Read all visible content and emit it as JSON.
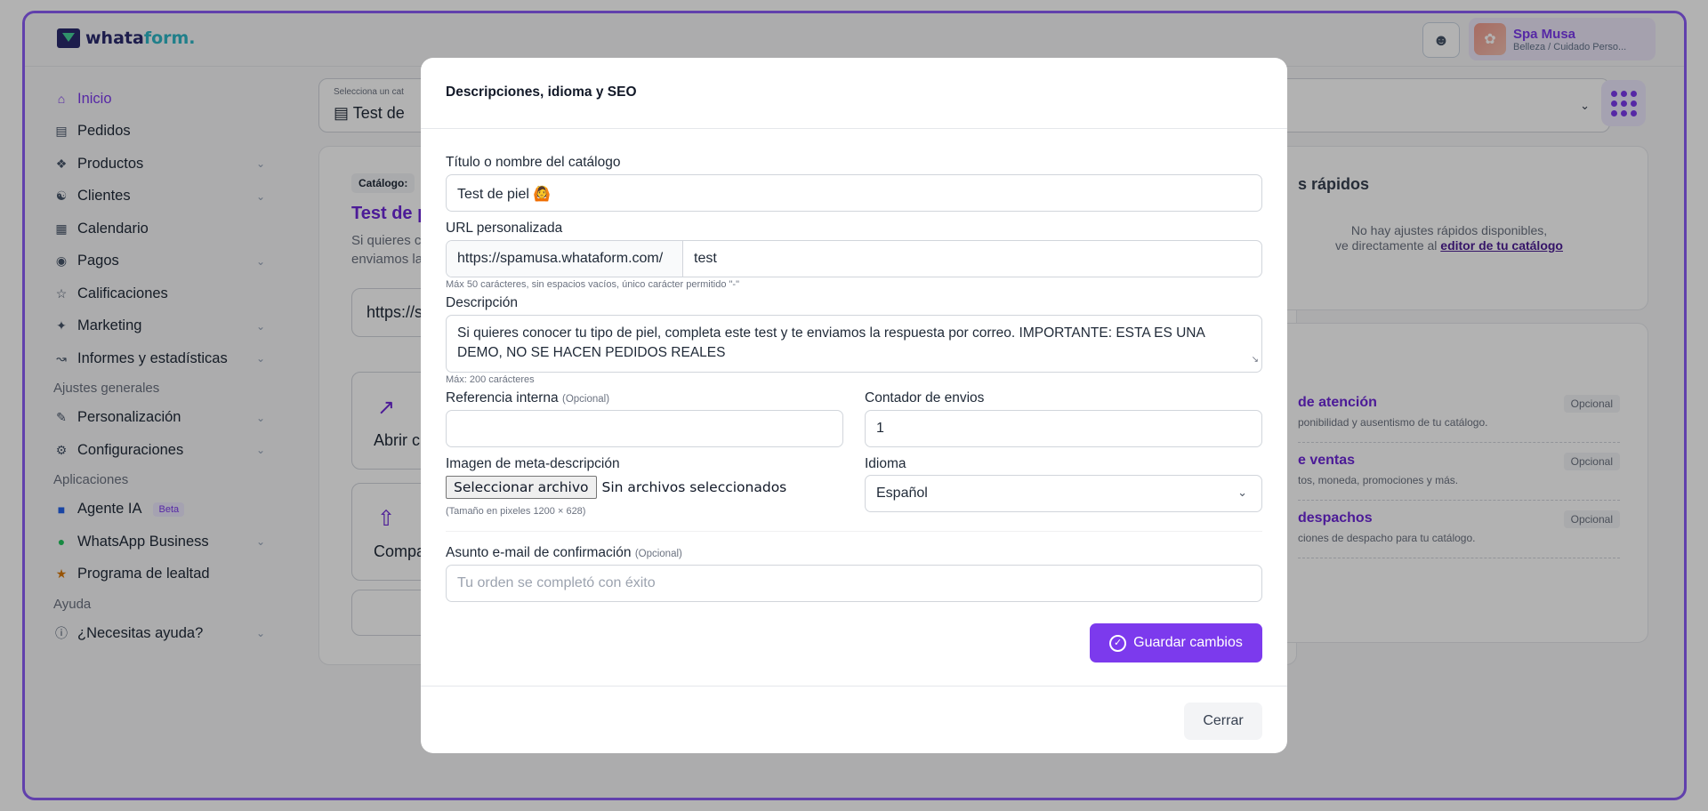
{
  "app": {
    "logo_main": "whata",
    "logo_accent": "form."
  },
  "account": {
    "name": "Spa Musa",
    "subtitle": "Belleza / Cuidado Perso..."
  },
  "sidebar": {
    "items": [
      {
        "label": "Inicio",
        "icon": "home-icon"
      },
      {
        "label": "Pedidos",
        "icon": "orders-icon"
      },
      {
        "label": "Productos",
        "icon": "products-icon"
      },
      {
        "label": "Clientes",
        "icon": "clients-icon"
      },
      {
        "label": "Calendario",
        "icon": "calendar-icon"
      },
      {
        "label": "Pagos",
        "icon": "payments-icon"
      },
      {
        "label": "Calificaciones",
        "icon": "star-icon"
      },
      {
        "label": "Marketing",
        "icon": "marketing-icon"
      },
      {
        "label": "Informes y estadísticas",
        "icon": "chart-icon"
      }
    ],
    "section_general": "Ajustes generales",
    "general_items": [
      {
        "label": "Personalización",
        "icon": "brush-icon"
      },
      {
        "label": "Configuraciones",
        "icon": "gear-icon"
      }
    ],
    "section_apps": "Aplicaciones",
    "app_items": [
      {
        "label": "Agente IA",
        "badge": "Beta",
        "icon": "robot-icon"
      },
      {
        "label": "WhatsApp Business",
        "icon": "whatsapp-icon"
      },
      {
        "label": "Programa de lealtad",
        "icon": "medal-icon"
      }
    ],
    "section_help": "Ayuda",
    "help_items": [
      {
        "label": "¿Necesitas ayuda?",
        "icon": "help-icon"
      }
    ]
  },
  "background": {
    "catalog_select_label": "Selecciona un cat",
    "catalog_select_value": "Test de",
    "catalog_tag": "Catálogo:",
    "catalog_title": "Test de p",
    "catalog_desc_line1": "Si quieres c",
    "catalog_desc_line2": "enviamos la",
    "catalog_url": "https://s",
    "tile_open": "Abrir c",
    "tile_share": "Compa",
    "quick_title": "s rápidos",
    "quick_msg_line1": "No hay ajustes rápidos disponibles,",
    "quick_msg_line2": "ve directamente al ",
    "quick_msg_link": "editor de tu catálogo",
    "options": [
      {
        "title": "de atención",
        "desc": "ponibilidad y ausentismo de tu catálogo.",
        "badge": "Opcional"
      },
      {
        "title": "e ventas",
        "desc": "tos, moneda, promociones y más.",
        "badge": "Opcional"
      },
      {
        "title": "despachos",
        "desc": "ciones de despacho para tu catálogo.",
        "badge": "Opcional"
      }
    ]
  },
  "modal": {
    "title": "Descripciones, idioma y SEO",
    "catalog_name_label": "Título o nombre del catálogo",
    "catalog_name_value": "Test de piel 🙆",
    "url_label": "URL personalizada",
    "url_prefix": "https://spamusa.whataform.com/",
    "url_slug": "test",
    "url_hint": "Máx 50 carácteres, sin espacios vacíos, único carácter permitido \"-\"",
    "description_label": "Descripción",
    "description_line1": "Si quieres conocer tu tipo de piel, completa este test y te enviamos la respuesta por correo. IMPORTANTE: ESTA ES UNA",
    "description_line2": "DEMO, NO SE HACEN PEDIDOS REALES",
    "description_hint": "Máx: 200 carácteres",
    "internal_ref_label": "Referencia interna",
    "optional_tag": "(Opcional)",
    "internal_ref_value": "",
    "counter_label": "Contador de envios",
    "counter_value": "1",
    "meta_image_label": "Imagen de meta-descripción",
    "file_button": "Seleccionar archivo",
    "file_status": "Sin archivos seleccionados",
    "meta_image_hint": "(Tamaño en pixeles 1200 × 628)",
    "language_label": "Idioma",
    "language_value": "Español",
    "email_subject_label": "Asunto e-mail de confirmación",
    "email_subject_placeholder": "Tu orden se completó con éxito",
    "save_label": "Guardar cambios",
    "close_label": "Cerrar"
  },
  "colors": {
    "accent": "#7c3aed",
    "frame": "#8b5cf6"
  }
}
